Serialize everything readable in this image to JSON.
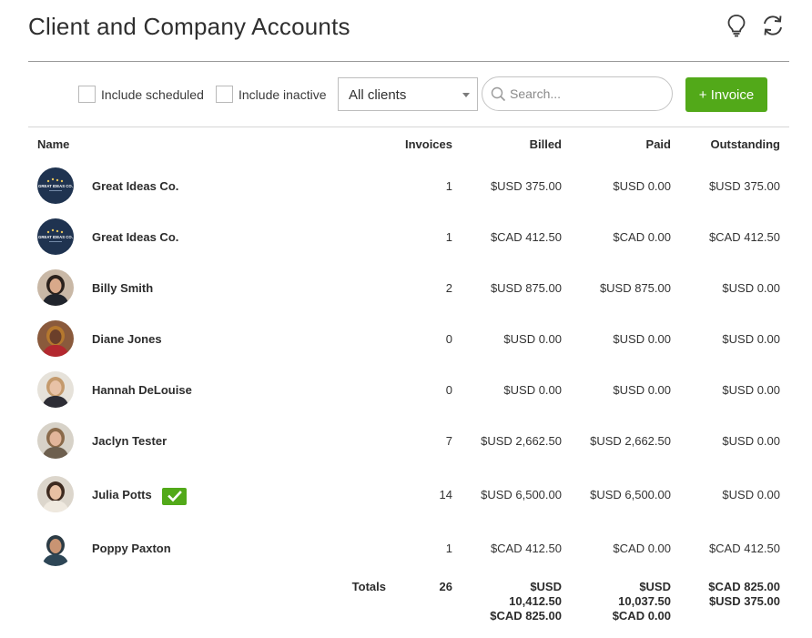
{
  "header": {
    "title": "Client and Company Accounts",
    "icons": [
      "lightbulb-icon",
      "refresh-icon"
    ]
  },
  "toolbar": {
    "include_scheduled": "Include scheduled",
    "include_inactive": "Include inactive",
    "client_filter": "All clients",
    "search_placeholder": "Search...",
    "invoice_button": "+ Invoice"
  },
  "columns": {
    "name": "Name",
    "invoices": "Invoices",
    "billed": "Billed",
    "paid": "Paid",
    "outstanding": "Outstanding"
  },
  "rows": [
    {
      "name": "Great Ideas Co.",
      "invoices": "1",
      "billed": "$USD 375.00",
      "paid": "$USD 0.00",
      "outstanding": "$USD 375.00",
      "avatar": "company-logo",
      "logo_text": "GREAT IDEAS CO."
    },
    {
      "name": "Great Ideas Co.",
      "invoices": "1",
      "billed": "$CAD 412.50",
      "paid": "$CAD 0.00",
      "outstanding": "$CAD 412.50",
      "avatar": "company-logo",
      "logo_text": "GREAT IDEAS CO."
    },
    {
      "name": "Billy Smith",
      "invoices": "2",
      "billed": "$USD 875.00",
      "paid": "$USD 875.00",
      "outstanding": "$USD 0.00",
      "avatar": "photo"
    },
    {
      "name": "Diane Jones",
      "invoices": "0",
      "billed": "$USD 0.00",
      "paid": "$USD 0.00",
      "outstanding": "$USD 0.00",
      "avatar": "photo"
    },
    {
      "name": "Hannah DeLouise",
      "invoices": "0",
      "billed": "$USD 0.00",
      "paid": "$USD 0.00",
      "outstanding": "$USD 0.00",
      "avatar": "photo"
    },
    {
      "name": "Jaclyn Tester",
      "invoices": "7",
      "billed": "$USD 2,662.50",
      "paid": "$USD 2,662.50",
      "outstanding": "$USD 0.00",
      "avatar": "photo"
    },
    {
      "name": "Julia Potts",
      "invoices": "14",
      "billed": "$USD 6,500.00",
      "paid": "$USD 6,500.00",
      "outstanding": "$USD 0.00",
      "avatar": "photo",
      "badge": "check-icon"
    },
    {
      "name": "Poppy Paxton",
      "invoices": "1",
      "billed": "$CAD 412.50",
      "paid": "$CAD 0.00",
      "outstanding": "$CAD 412.50",
      "avatar": "photo"
    }
  ],
  "totals": {
    "label": "Totals",
    "invoices": "26",
    "billed": [
      "$USD",
      "10,412.50",
      "$CAD 825.00"
    ],
    "paid": [
      "$USD",
      "10,037.50",
      "$CAD 0.00"
    ],
    "outstanding": [
      "$CAD 825.00",
      "$USD 375.00"
    ]
  },
  "colors": {
    "accent_green": "#52a919",
    "logo_navy": "#1f3350"
  }
}
